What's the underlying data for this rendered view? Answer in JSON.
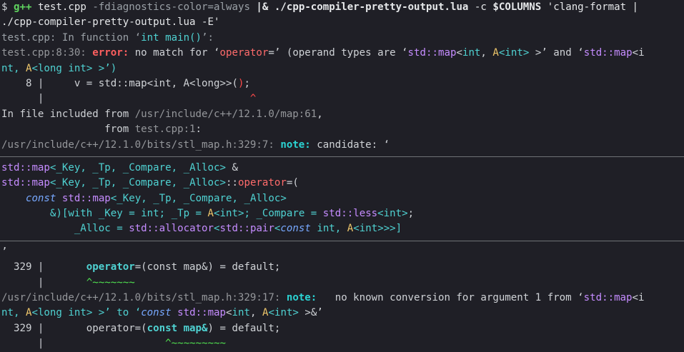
{
  "line1": {
    "prompt": "$ ",
    "cmd": "g++",
    "a1": " test.cpp ",
    "a2": "-fdiagnostics-color=always",
    "pipe": " |& ",
    "script": "./cpp-compiler-pretty-output.lua",
    "a3": " -c ",
    "cols": "$COLUMNS",
    "a4": " 'clang-format |"
  },
  "line2": "./cpp-compiler-pretty-output.lua -E'",
  "line3": {
    "pre": "test.cpp: In function ‘",
    "fn": "int main()",
    "post": "’:"
  },
  "line4": {
    "loc": "test.cpp:8:30: ",
    "err": "error:",
    "t1": " no match for ‘",
    "op": "operator",
    "t2": "=’ (operand types are ‘",
    "std": "std::",
    "map": "map",
    "lt": "<",
    "int": "int",
    "comma": ", ",
    "a": "A",
    "aint": "<int>",
    "rest": " >’ and ‘",
    "std2": "std::",
    "map2": "map",
    "lt2": "<i"
  },
  "line5": {
    "p1": "nt, ",
    "a": "A",
    "p2": "<long int> >’)"
  },
  "line6": {
    "gutter": "    8 |   ",
    "code": "  v = std::map<int, A<long>>(",
    "hl": ")",
    "end": ";"
  },
  "line7": {
    "gutter": "      |",
    "caret": "^",
    "caret_pad": "                                  "
  },
  "line8": {
    "pre": "In file included from ",
    "path": "/usr/include/c++/12.1.0/map:61",
    "post": ","
  },
  "line9": {
    "pad": "                 from ",
    "path": "test.cpp:1",
    "post": ":"
  },
  "line10": {
    "path": "/usr/include/c++/12.1.0/bits/stl_map.h:329:7:",
    "note": "note:",
    "post": " candidate: ‘"
  },
  "line11": {
    "std": "std::",
    "map": "map",
    "tpl": "<_Key, _Tp, _Compare, _Alloc>",
    "amp": " &"
  },
  "line12": {
    "std": "std::",
    "map": "map",
    "tpl": "<_Key, _Tp, _Compare, _Alloc>",
    "sep": "::",
    "op": "operator",
    "eq": "=("
  },
  "line13": {
    "pad": "    ",
    "kw": "const",
    "sp": " ",
    "std": "std::",
    "map": "map",
    "tpl": "<_Key, _Tp, _Compare, _Alloc>"
  },
  "line14": {
    "pad": "        &)[with _Key = ",
    "int": "int",
    "t1": "; _Tp = ",
    "a": "A",
    "aint": "<int>",
    "t2": "; _Compare = ",
    "std": "std::",
    "less": "less",
    "lint": "<int>",
    "end": ";"
  },
  "line15": {
    "pad": "            _Alloc = ",
    "std": "std::",
    "alloc": "allocator",
    "lt": "<",
    "std2": "std::",
    "pair": "pair",
    "lt2": "<",
    "kw": "const",
    "mid": " int, ",
    "a": "A",
    "end": "<int>>>]"
  },
  "line16": "’",
  "line17": {
    "gutter": "  329 |       ",
    "op": "operator",
    "rest": "=(const map&) = default;"
  },
  "line18": {
    "gutter": "      |       ",
    "caret": "^~~~~~~~"
  },
  "line19": {
    "path": "/usr/include/c++/12.1.0/bits/stl_map.h:329:17:",
    "note": "note:",
    "t1": "   no known conversion for argument 1 from ‘",
    "std": "std::",
    "map": "map",
    "lt": "<i"
  },
  "line20": {
    "p1": "nt, ",
    "a": "A",
    "p2": "<long int> >’ to ‘",
    "kw": "const",
    "sp": " ",
    "std": "std::",
    "map": "map",
    "lt": "<",
    "int": "int",
    "comma": ", ",
    "a2": "A",
    "aint": "<int>",
    "end": " >&’"
  },
  "line21": {
    "gutter": "  329 |       ",
    "op": "operator=(",
    "cm": "const map&",
    "rest": ") = default;"
  },
  "line22": {
    "gutter": "      |       ",
    "pad": "             ",
    "caret": "^~~~~~~~~~"
  }
}
